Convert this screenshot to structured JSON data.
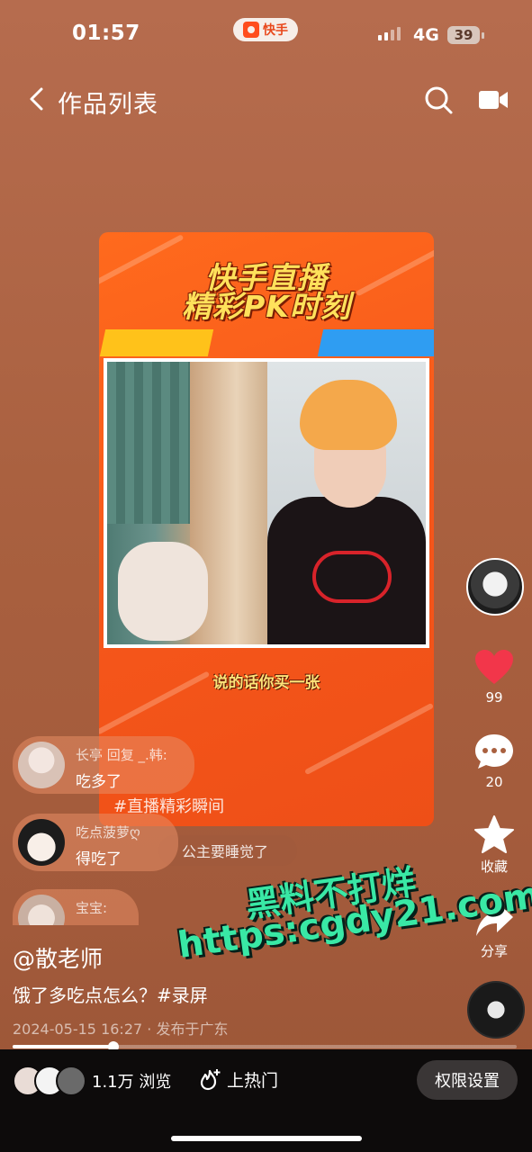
{
  "status_bar": {
    "time": "01:57",
    "app_name": "快手",
    "network": "4G",
    "battery": "39"
  },
  "nav": {
    "title": "作品列表"
  },
  "video": {
    "title_line1": "快手直播",
    "title_line2": "精彩PK时刻",
    "caption": "说的话你买一张",
    "hashtag": "#直播精彩瞬间",
    "sub_label": "公主要睡觉了"
  },
  "comments": [
    {
      "user": "长亭 回复 _.韩:",
      "text": "吃多了"
    },
    {
      "user": "吃点菠萝ღ",
      "text": "得吃了"
    },
    {
      "user": "宝宝:",
      "text": ""
    }
  ],
  "watermark": {
    "line1": "黑料不打烊",
    "line2": "https:cgdy21.com"
  },
  "rail": {
    "likes": "99",
    "comments": "20",
    "favorite_label": "收藏",
    "share_label": "分享"
  },
  "post": {
    "author": "@散老师",
    "description": "饿了多吃点怎么？#录屏",
    "meta": "2024-05-15 16:27 · 发布于广东",
    "progress": 0.2
  },
  "bottom": {
    "views": "1.1万 浏览",
    "hot_label": "上热门",
    "permission_label": "权限设置"
  },
  "colors": {
    "like": "#f2364a",
    "accent_orange": "#f5561a",
    "watermark": "#39e8a5"
  }
}
